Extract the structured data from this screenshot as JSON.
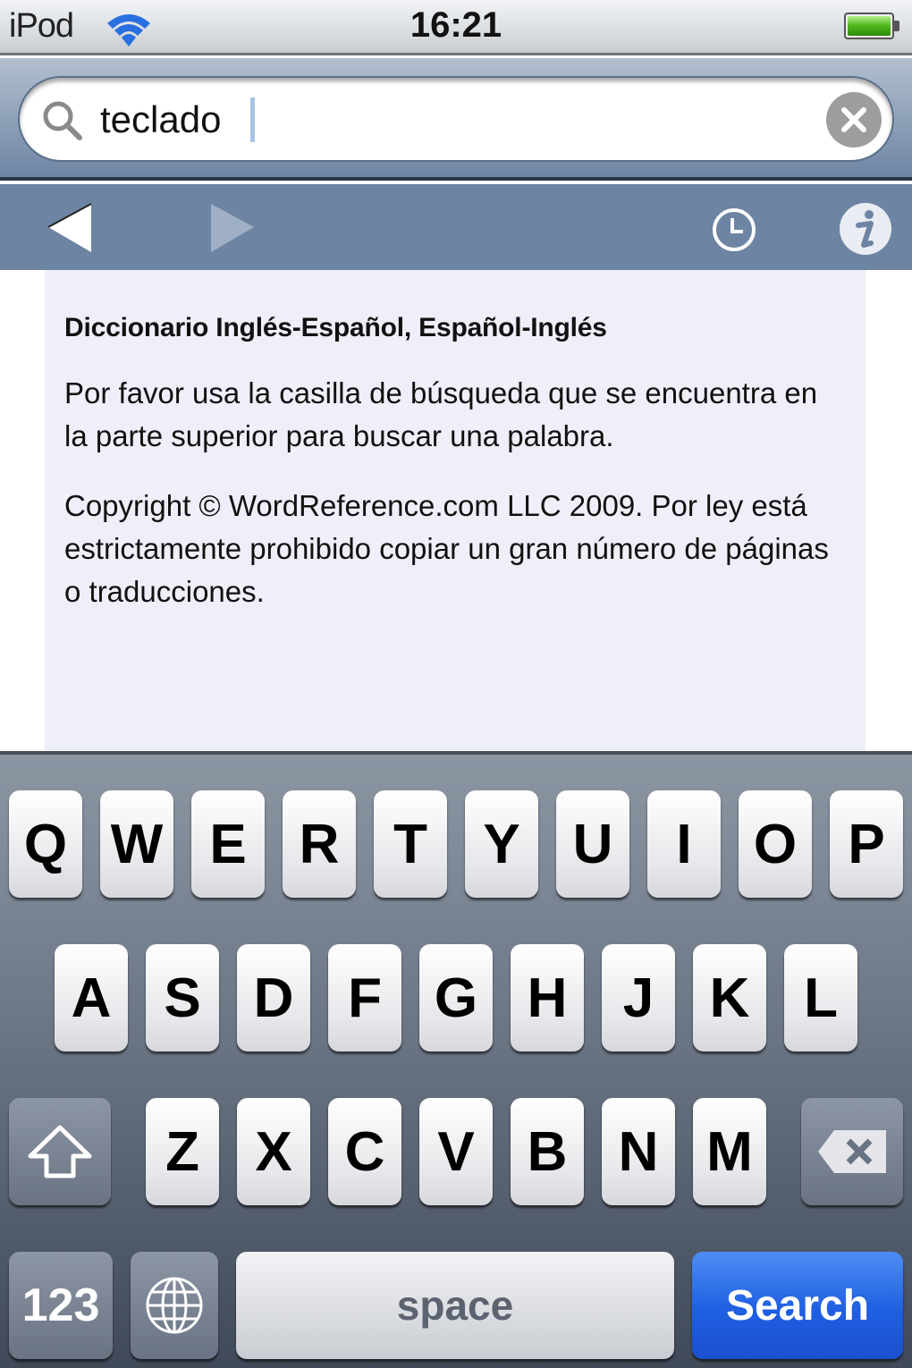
{
  "status_bar": {
    "carrier": "iPod",
    "time": "16:21",
    "wifi_icon": "wifi-icon",
    "battery_level": 1.0,
    "battery_color": "#4cb51a"
  },
  "search": {
    "value": "teclado",
    "placeholder": "",
    "search_icon": "search-icon",
    "clear_icon": "clear-icon"
  },
  "toolbar": {
    "back_icon": "back-arrow-icon",
    "forward_icon": "forward-arrow-icon",
    "history_icon": "clock-icon",
    "info_icon": "info-icon",
    "forward_enabled": false
  },
  "content": {
    "title": "Diccionario Inglés-Español, Español-Inglés",
    "instructions": "Por favor usa la casilla de búsqueda que se encuentra en la parte superior para buscar una palabra.",
    "copyright": "Copyright © WordReference.com LLC 2009. Por ley está estrictamente prohibido copiar un gran número de páginas o traducciones."
  },
  "keyboard": {
    "row1": [
      "Q",
      "W",
      "E",
      "R",
      "T",
      "Y",
      "U",
      "I",
      "O",
      "P"
    ],
    "row2": [
      "A",
      "S",
      "D",
      "F",
      "G",
      "H",
      "J",
      "K",
      "L"
    ],
    "row3": [
      "Z",
      "X",
      "C",
      "V",
      "B",
      "N",
      "M"
    ],
    "shift_icon": "shift-icon",
    "delete_icon": "backspace-icon",
    "numbers_label": "123",
    "globe_icon": "globe-icon",
    "space_label": "space",
    "search_label": "Search",
    "search_color": "#1f5fe1"
  }
}
